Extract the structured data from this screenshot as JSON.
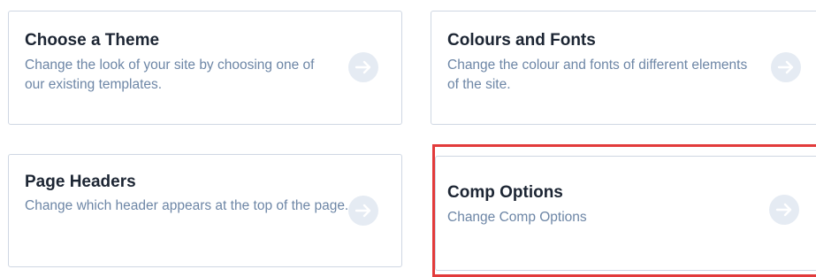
{
  "cards": [
    {
      "title": "Choose a Theme",
      "description": "Change the look of your site by choosing one of our existing templates.",
      "arrow_icon": "arrow-right-circle-icon"
    },
    {
      "title": "Colours and Fonts",
      "description": "Change the colour and fonts of different elements of the site.",
      "arrow_icon": "arrow-right-circle-icon"
    },
    {
      "title": "Page Headers",
      "description": "Change which header appears at the top of the page.",
      "arrow_icon": "arrow-right-circle-icon"
    },
    {
      "title": "Comp Options",
      "description": "Change Comp Options",
      "arrow_icon": "arrow-right-circle-icon"
    }
  ],
  "colors": {
    "title": "#1c2533",
    "description": "#6d86a6",
    "card_border": "#cfd7e3",
    "arrow_bg": "#e5ebf3",
    "highlight": "#e23b3b"
  }
}
